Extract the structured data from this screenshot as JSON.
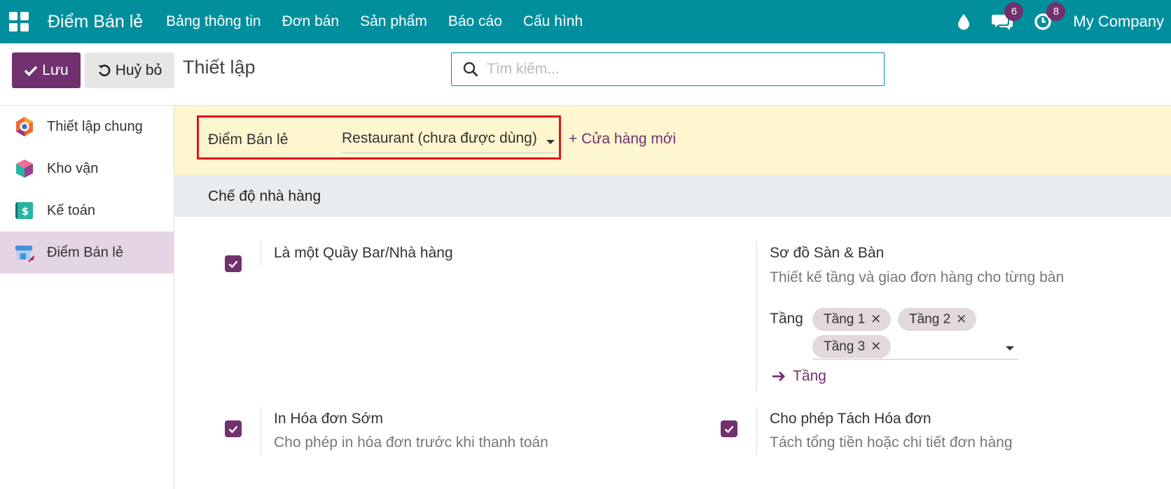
{
  "nav": {
    "app_name": "Điểm Bán lẻ",
    "menu": [
      "Bảng thông tin",
      "Đơn bán",
      "Sản phẩm",
      "Báo cáo",
      "Cấu hình"
    ],
    "messages_count": "6",
    "activities_count": "8",
    "company": "My Company"
  },
  "control": {
    "save_label": "Lưu",
    "discard_label": "Huỷ bỏ",
    "title": "Thiết lập",
    "search_placeholder": "Tìm kiếm..."
  },
  "sidebar": {
    "items": [
      {
        "label": "Thiết lập chung",
        "icon": "general-settings-icon"
      },
      {
        "label": "Kho vận",
        "icon": "inventory-icon"
      },
      {
        "label": "Kế toán",
        "icon": "accounting-icon"
      },
      {
        "label": "Điểm Bán lẻ",
        "icon": "point-of-sale-icon",
        "active": true
      }
    ]
  },
  "pos": {
    "label": "Điểm Bán lẻ",
    "selected": "Restaurant (chưa được dùng)",
    "new_shop_label": "+ Cửa hàng mới"
  },
  "section": {
    "title": "Chế độ nhà hàng"
  },
  "options": {
    "bar_restaurant": {
      "title": "Là một Quầy Bar/Nhà hàng",
      "checked": true
    },
    "floor_plan": {
      "title": "Sơ đồ Sàn & Bàn",
      "description": "Thiết kế tầng và giao đơn hàng cho từng bàn",
      "floors_label": "Tầng",
      "floors": [
        "Tầng 1",
        "Tầng 2",
        "Tầng 3"
      ],
      "link_label": "Tầng"
    },
    "early_receipt": {
      "title": "In Hóa đơn Sớm",
      "description": "Cho phép in hóa đơn trước khi thanh toán",
      "checked": true
    },
    "split_bill": {
      "title": "Cho phép Tách Hóa đơn",
      "description": "Tách tổng tiền hoặc chi tiết đơn hàng",
      "checked": true
    }
  },
  "colors": {
    "nav": "#018f9e",
    "primary": "#71306e",
    "highlight": "#e2121b",
    "banner": "#fdf6cf"
  }
}
